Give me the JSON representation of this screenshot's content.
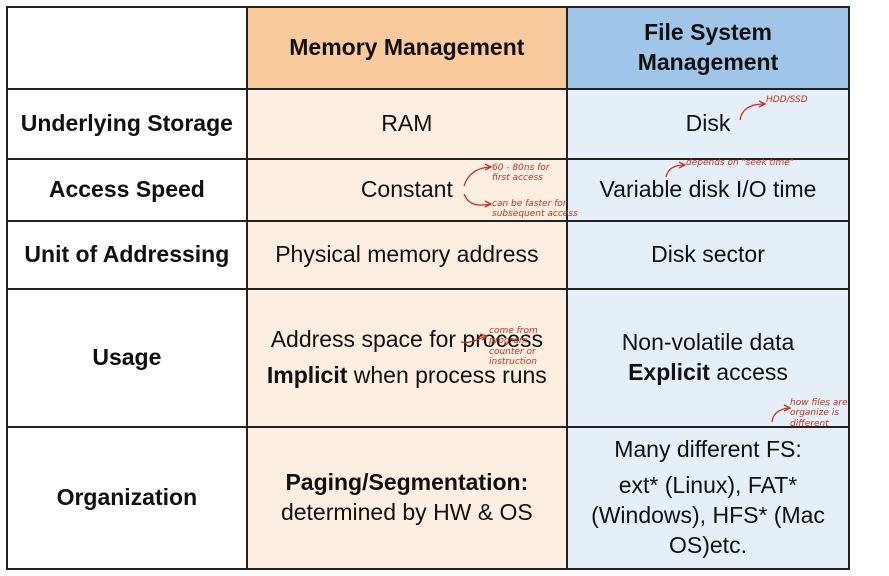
{
  "header": {
    "memory_title": "Memory Management",
    "fs_title": "File System Management"
  },
  "rows": {
    "storage": {
      "label": "Underlying Storage",
      "memory": "RAM",
      "fs": "Disk",
      "note_fs": "HDD/SSD"
    },
    "speed": {
      "label": "Access Speed",
      "memory": "Constant",
      "fs": "Variable disk I/O time",
      "note_memory_1": "60 - 80ns for first access",
      "note_memory_2": "can be faster for subsequent access",
      "note_fs": "depends on \"seek time\""
    },
    "addressing": {
      "label": "Unit of Addressing",
      "memory": "Physical memory address",
      "fs": "Disk sector"
    },
    "usage": {
      "label": "Usage",
      "memory_line1": "Address space for process",
      "memory_bold": "Implicit",
      "memory_rest": "when process runs",
      "fs_line1": "Non-volatile data",
      "fs_bold": "Explicit",
      "fs_rest": "access",
      "note_memory": "come from program counter or instruction",
      "note_fs": "how files are organize is different"
    },
    "organization": {
      "label": "Organization",
      "memory_bold": "Paging/Segmentation:",
      "memory_rest": "determined by HW & OS",
      "fs_line1": "Many different FS:",
      "fs_line2": "ext* (Linux), FAT* (Windows), HFS* (Mac OS)etc."
    }
  },
  "colors": {
    "memory_header": "#f9cb9c",
    "memory_cell": "#fdeee2",
    "fs_header": "#9fc5e8",
    "fs_cell": "#e5eff8",
    "annotation": "#c8321e"
  }
}
